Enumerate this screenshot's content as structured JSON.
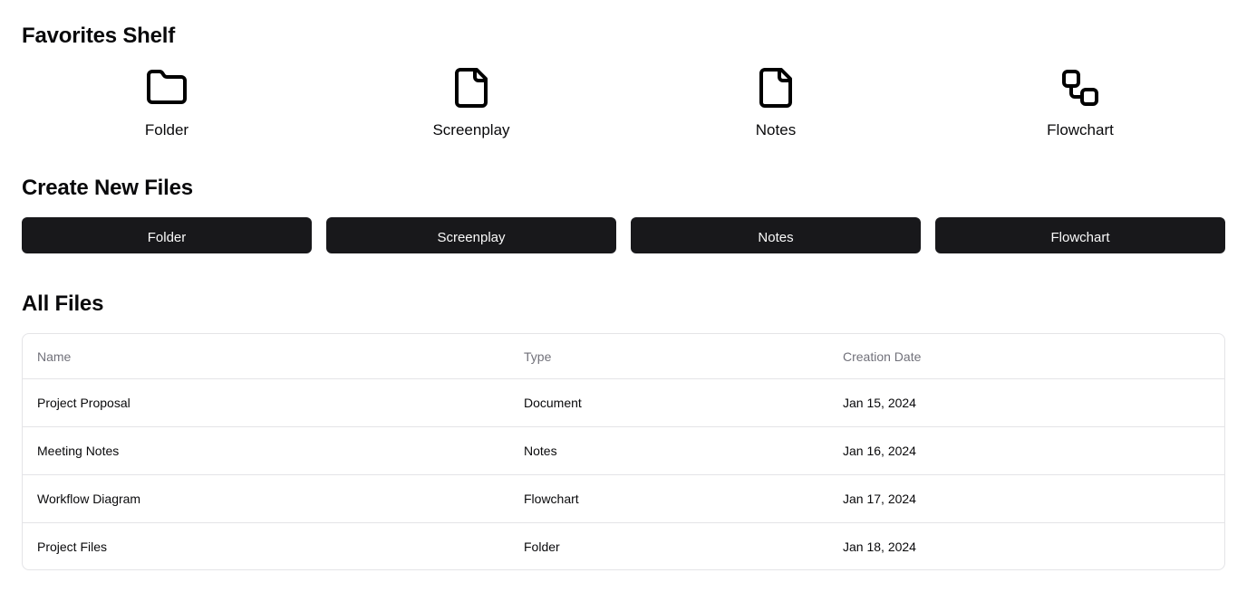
{
  "favorites": {
    "title": "Favorites Shelf",
    "items": [
      {
        "label": "Folder",
        "icon": "folder-icon"
      },
      {
        "label": "Screenplay",
        "icon": "file-icon"
      },
      {
        "label": "Notes",
        "icon": "file-icon"
      },
      {
        "label": "Flowchart",
        "icon": "workflow-icon"
      }
    ]
  },
  "create": {
    "title": "Create New Files",
    "buttons": [
      "Folder",
      "Screenplay",
      "Notes",
      "Flowchart"
    ]
  },
  "files": {
    "title": "All Files",
    "columns": [
      "Name",
      "Type",
      "Creation Date"
    ],
    "rows": [
      {
        "name": "Project Proposal",
        "type": "Document",
        "date": "Jan 15, 2024"
      },
      {
        "name": "Meeting Notes",
        "type": "Notes",
        "date": "Jan 16, 2024"
      },
      {
        "name": "Workflow Diagram",
        "type": "Flowchart",
        "date": "Jan 17, 2024"
      },
      {
        "name": "Project Files",
        "type": "Folder",
        "date": "Jan 18, 2024"
      }
    ]
  },
  "colors": {
    "button_bg": "#18181b",
    "button_text": "#fafafa",
    "border": "#e4e4e7",
    "muted_text": "#71717a"
  }
}
